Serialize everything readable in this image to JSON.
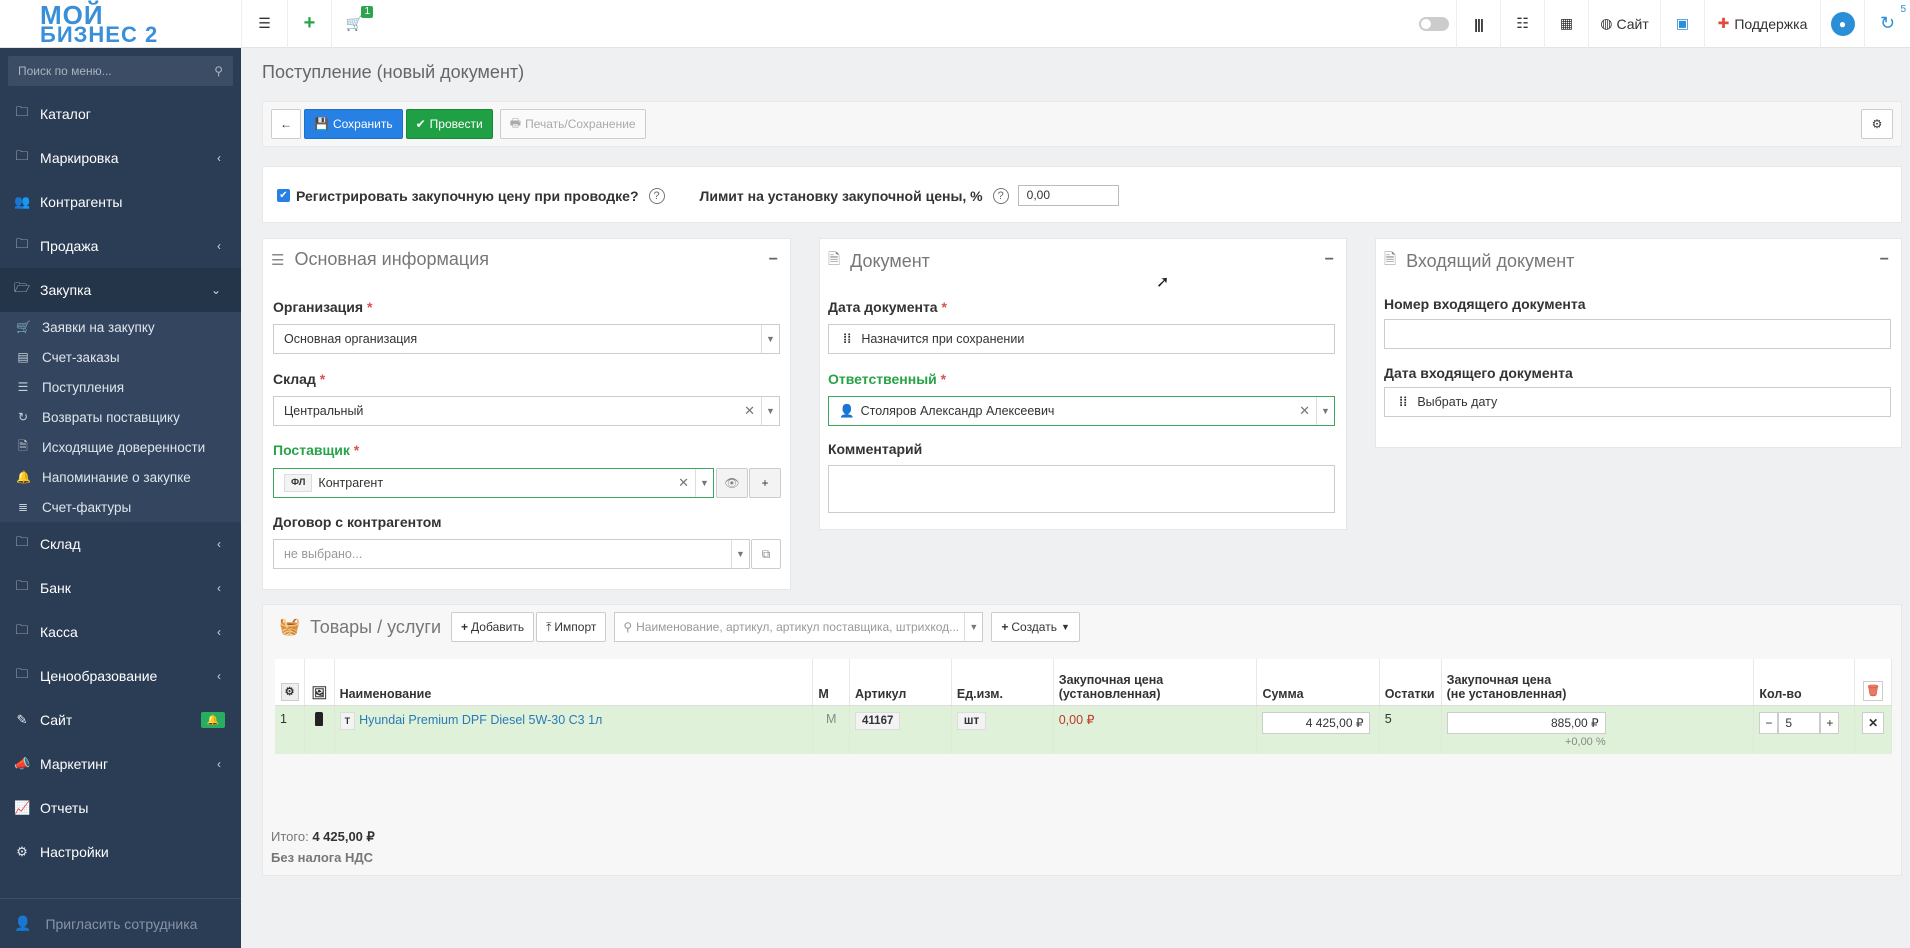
{
  "logo": {
    "line1": "МОЙ",
    "line2": "БИЗНЕС 2"
  },
  "topbar": {
    "cart_badge": "1",
    "site_label": "Сайт",
    "support_label": "Поддержка",
    "notif_badge": "5"
  },
  "sidebar": {
    "search_placeholder": "Поиск по меню...",
    "items": [
      {
        "label": "Каталог",
        "icon": "folder-icon"
      },
      {
        "label": "Маркировка",
        "icon": "folder-icon",
        "chev": "‹"
      },
      {
        "label": "Контрагенты",
        "icon": "users-icon"
      },
      {
        "label": "Продажа",
        "icon": "folder-icon",
        "chev": "‹"
      },
      {
        "label": "Закупка",
        "icon": "folder-icon",
        "chev": "⌄"
      }
    ],
    "subitems": [
      {
        "label": "Заявки на закупку"
      },
      {
        "label": "Счет-заказы"
      },
      {
        "label": "Поступления"
      },
      {
        "label": "Возвраты поставщику"
      },
      {
        "label": "Исходящие доверенности"
      },
      {
        "label": "Напоминание о закупке"
      },
      {
        "label": "Счет-фактуры"
      }
    ],
    "items2": [
      {
        "label": "Склад",
        "chev": "‹"
      },
      {
        "label": "Банк",
        "chev": "‹"
      },
      {
        "label": "Касса",
        "chev": "‹"
      },
      {
        "label": "Ценообразование",
        "chev": "‹"
      },
      {
        "label": "Сайт"
      },
      {
        "label": "Маркетинг",
        "chev": "‹"
      },
      {
        "label": "Отчеты"
      },
      {
        "label": "Настройки"
      }
    ],
    "invite": "Пригласить сотрудника"
  },
  "page": {
    "title": "Поступление (новый документ)"
  },
  "toolbar": {
    "save": "Сохранить",
    "post": "Провести",
    "print": "Печать/Сохранение"
  },
  "options": {
    "register_label": "Регистрировать закупочную цену при проводке?",
    "register_checked": true,
    "limit_label": "Лимит на установку закупочной цены, %",
    "limit_value": "0,00"
  },
  "basic": {
    "title": "Основная информация",
    "org_label": "Организация",
    "org_value": "Основная организация",
    "warehouse_label": "Склад",
    "warehouse_value": "Центральный",
    "supplier_label": "Поставщик",
    "supplier_tag": "ФЛ",
    "supplier_value": "Контрагент",
    "contract_label": "Договор с контрагентом",
    "contract_placeholder": "не выбрано..."
  },
  "document": {
    "title": "Документ",
    "date_label": "Дата документа",
    "date_value": "Назначится при сохранении",
    "resp_label": "Ответственный",
    "resp_value": "Столяров Александр Алексеевич",
    "comment_label": "Комментарий"
  },
  "incoming": {
    "title": "Входящий документ",
    "number_label": "Номер входящего документа",
    "date_label": "Дата входящего документа",
    "date_value": "Выбрать дату"
  },
  "goods": {
    "title": "Товары / услуги",
    "add": "Добавить",
    "import": "Импорт",
    "search_placeholder": "Наименование, артикул, артикул поставщика, штрихкод...",
    "create": "Создать",
    "columns": {
      "name": "Наименование",
      "m": "М",
      "article": "Артикул",
      "unit": "Ед.изм.",
      "price_set_1": "Закупочная цена",
      "price_set_2": "(установленная)",
      "sum": "Сумма",
      "stock": "Остатки",
      "price_unset_1": "Закупочная цена",
      "price_unset_2": "(не установленная)",
      "qty": "Кол-во"
    },
    "rows": [
      {
        "num": "1",
        "type": "Т",
        "name": "Hyundai Premium DPF Diesel 5W-30 C3 1л",
        "m": "М",
        "article": "41167",
        "unit": "шт",
        "price_set": "0,00 ₽",
        "sum": "4 425,00 ₽",
        "stock": "5",
        "price_unset": "885,00 ₽",
        "markup": "+0,00 %",
        "qty": "5"
      }
    ],
    "total_label": "Итого:",
    "total_value": "4 425,00 ₽",
    "vat": "Без налога НДС"
  },
  "colors": {
    "sidebar": "#2b3c55",
    "primary": "#2780e3",
    "success": "#20a045",
    "row": "#dff1d9"
  }
}
